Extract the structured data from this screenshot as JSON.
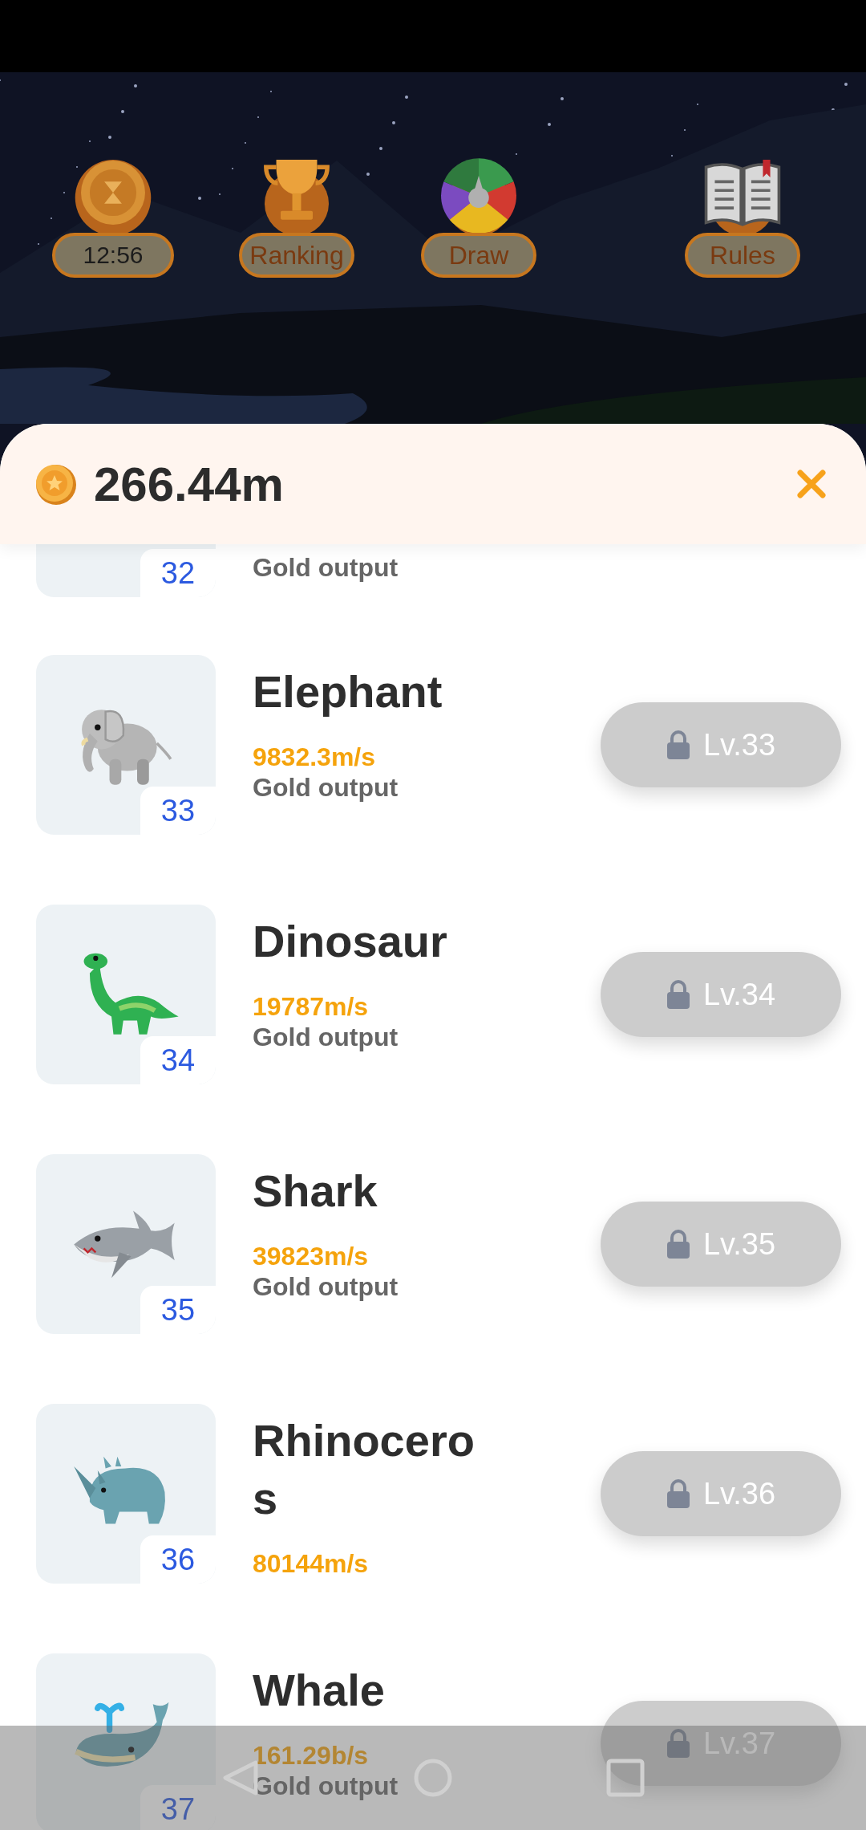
{
  "top_menu": [
    {
      "kind": "timer",
      "label": "12:56"
    },
    {
      "kind": "ranking",
      "label": "Ranking"
    },
    {
      "kind": "draw",
      "label": "Draw"
    },
    {
      "kind": "rules",
      "label": "Rules"
    }
  ],
  "sheet": {
    "balance": "266.44m",
    "animals": [
      {
        "number": "32",
        "label": "Gold output"
      },
      {
        "kind": "elephant",
        "number": "33",
        "name": "Elephant",
        "rate": "9832.3m/s",
        "label": "Gold output",
        "button": {
          "text": "Lv.33",
          "locked": true
        }
      },
      {
        "kind": "dinosaur",
        "number": "34",
        "name": "Dinosaur",
        "rate": "19787m/s",
        "label": "Gold output",
        "button": {
          "text": "Lv.34",
          "locked": true
        }
      },
      {
        "kind": "shark",
        "number": "35",
        "name": "Shark",
        "rate": "39823m/s",
        "label": "Gold output",
        "button": {
          "text": "Lv.35",
          "locked": true
        }
      },
      {
        "kind": "rhinoceros",
        "number": "36",
        "name": "Rhinoceros",
        "rate": "80144m/s",
        "button": {
          "text": "Lv.36",
          "locked": true
        }
      },
      {
        "kind": "whale",
        "number": "37",
        "name": "Whale",
        "rate": "161.29b/s",
        "label": "Gold output",
        "button": {
          "text": "Lv.37",
          "locked": true
        }
      }
    ]
  }
}
